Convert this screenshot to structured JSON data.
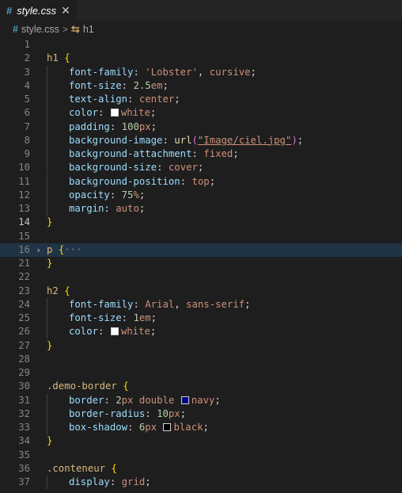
{
  "tab": {
    "icon": "css-hash-icon",
    "label": "style.css",
    "close": "✕"
  },
  "breadcrumb": {
    "file": "style.css",
    "symbol": "h1"
  },
  "colors": {
    "white": "#ffffff",
    "navy": "#000080",
    "black": "#000000"
  },
  "lines": [
    {
      "n": "1",
      "code": ""
    },
    {
      "n": "2",
      "code": "h1 {"
    },
    {
      "n": "3",
      "code": "font-family: 'Lobster', cursive;"
    },
    {
      "n": "4",
      "code": "font-size: 2.5em;"
    },
    {
      "n": "5",
      "code": "text-align: center;"
    },
    {
      "n": "6",
      "code": "color: white;"
    },
    {
      "n": "7",
      "code": "padding: 100px;"
    },
    {
      "n": "8",
      "code": "background-image: url(\"Image/ciel.jpg\");"
    },
    {
      "n": "9",
      "code": "background-attachment: fixed;"
    },
    {
      "n": "10",
      "code": "background-size: cover;"
    },
    {
      "n": "11",
      "code": "background-position: top;"
    },
    {
      "n": "12",
      "code": "opacity: 75%;"
    },
    {
      "n": "13",
      "code": "margin: auto;"
    },
    {
      "n": "14",
      "code": "}"
    },
    {
      "n": "15",
      "code": ""
    },
    {
      "n": "16",
      "code": "p {···"
    },
    {
      "n": "21",
      "code": "}"
    },
    {
      "n": "22",
      "code": ""
    },
    {
      "n": "23",
      "code": "h2 {"
    },
    {
      "n": "24",
      "code": "font-family: Arial, sans-serif;"
    },
    {
      "n": "25",
      "code": "font-size: 1em;"
    },
    {
      "n": "26",
      "code": "color: white;"
    },
    {
      "n": "27",
      "code": "}"
    },
    {
      "n": "28",
      "code": ""
    },
    {
      "n": "29",
      "code": ""
    },
    {
      "n": "30",
      "code": ".demo-border {"
    },
    {
      "n": "31",
      "code": "border: 2px double navy;"
    },
    {
      "n": "32",
      "code": "border-radius: 10px;"
    },
    {
      "n": "33",
      "code": "box-shadow: 6px black;"
    },
    {
      "n": "34",
      "code": "}"
    },
    {
      "n": "35",
      "code": ""
    },
    {
      "n": "36",
      "code": ".conteneur {"
    },
    {
      "n": "37",
      "code": "display: grid;"
    }
  ],
  "fold_marker": "›"
}
